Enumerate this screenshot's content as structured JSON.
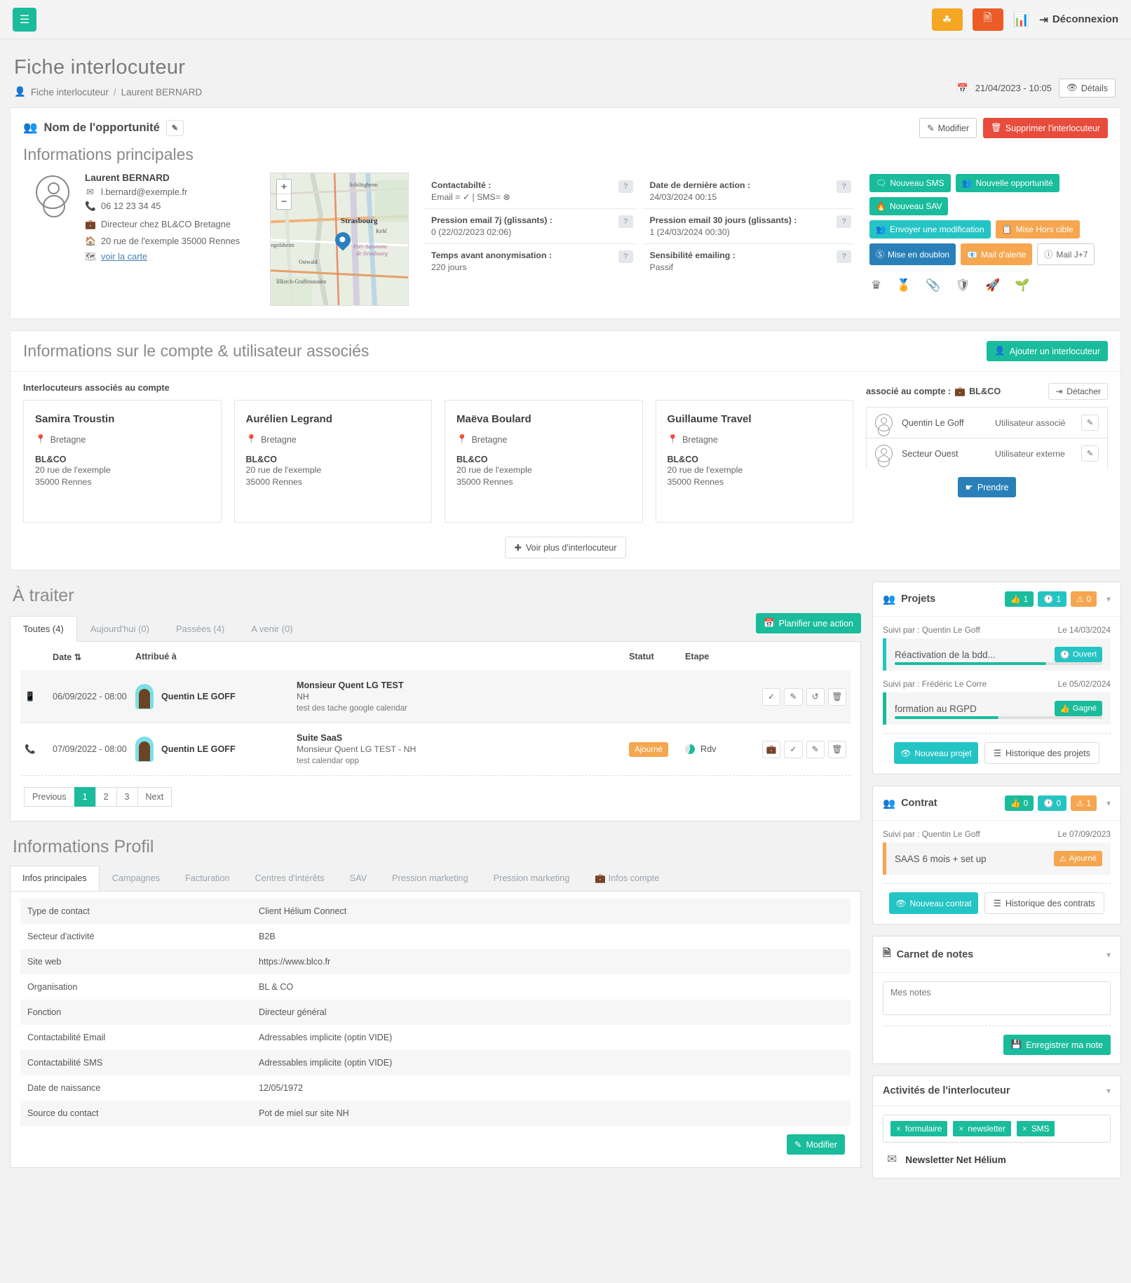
{
  "topbar": {
    "menu_icon": "hamburger-icon",
    "bulb_icon": "lightbulb-icon",
    "doc_icon": "document-alert-icon",
    "activity_icon": "activity-monitor-icon",
    "logout_label": "Déconnexion"
  },
  "page": {
    "title": "Fiche interlocuteur",
    "breadcrumb_root": "Fiche interlocuteur",
    "breadcrumb_sep": "/",
    "breadcrumb_current": "Laurent BERNARD",
    "timestamp": "21/04/2023 - 10:05",
    "details_label": "Détails"
  },
  "opportunity": {
    "title": "Nom de l'opportunité",
    "edit_label": "Modifier",
    "delete_label": "Supprimer l'interlocuteur"
  },
  "main_info": {
    "section_title": "Informations principales",
    "contact": {
      "name": "Laurent BERNARD",
      "email": "l.bernard@exemple.fr",
      "phone": "06 12 23 34 45",
      "job": "Directeur chez BL&CO Bretagne",
      "address": "20 rue de l'exemple 35000 Rennes",
      "map_link": "voir la carte"
    },
    "map": {
      "zoom_in": "+",
      "zoom_out": "−",
      "labels": [
        "Schiltigheim",
        "Strasbourg",
        "Kehl",
        "Ostwald",
        "Illkirch-Graffenstaden",
        "Lingolsheim",
        "Port Autonome de Strasbourg"
      ]
    },
    "fields": [
      {
        "label": "Contactabilté :",
        "value": "Email = ✓ | SMS= ⊗",
        "help": "?"
      },
      {
        "label": "Date de dernière action :",
        "value": "24/03/2024 00:15",
        "help": "?"
      },
      {
        "label": "Pression email 7j (glissants) :",
        "value": "0 (22/02/2023 02:06)",
        "help": "?"
      },
      {
        "label": "Pression email 30 jours (glissants) :",
        "value": "1 (24/03/2024 00:30)",
        "help": "?"
      },
      {
        "label": "Temps avant anonymisation :",
        "value": "220 jours",
        "help": "?"
      },
      {
        "label": "Sensibilité emailing :",
        "value": "Passif",
        "help": "?"
      }
    ],
    "actions_row1": [
      {
        "label": "Nouveau SMS",
        "icon": "sms-icon",
        "style": "g"
      },
      {
        "label": "Nouvelle opportunité",
        "icon": "user-plus-icon",
        "style": "g"
      },
      {
        "label": "Nouveau SAV",
        "icon": "fire-icon",
        "style": "g"
      }
    ],
    "actions_row2": [
      {
        "label": "Envoyer une modification",
        "icon": "users-icon",
        "style": "t"
      },
      {
        "label": "Mise Hors cible",
        "icon": "target-off-icon",
        "style": "o"
      }
    ],
    "actions_row3": [
      {
        "label": "Mise en doublon",
        "icon": "duplicate-icon",
        "style": "b"
      },
      {
        "label": "Mail d'alerte",
        "icon": "mail-alert-icon",
        "style": "o"
      },
      {
        "label": "Mail J+7",
        "icon": "clock-icon",
        "style": "w"
      }
    ],
    "status_icons": [
      "crown-icon",
      "medal-icon",
      "paperclip-icon",
      "shield-icon",
      "rocket-icon",
      "seedling-icon"
    ]
  },
  "account": {
    "section_title": "Informations sur le compte & utilisateur associés",
    "add_button": "Ajouter un interlocuteur",
    "list_label": "Interlocuteurs associés au compte",
    "people": [
      {
        "name": "Samira Troustin",
        "region": "Bretagne",
        "company": "BL&CO",
        "street": "20 rue de l'exemple",
        "city": "35000 Rennes"
      },
      {
        "name": "Aurélien Legrand",
        "region": "Bretagne",
        "company": "BL&CO",
        "street": "20 rue de l'exemple",
        "city": "35000 Rennes"
      },
      {
        "name": "Maëva Boulard",
        "region": "Bretagne",
        "company": "BL&CO",
        "street": "20 rue de l'exemple",
        "city": "35000 Rennes"
      },
      {
        "name": "Guillaume Travel",
        "region": "Bretagne",
        "company": "BL&CO",
        "street": "20 rue de l'exemple",
        "city": "35000 Rennes"
      }
    ],
    "more_button": "Voir plus d'interlocuteur",
    "linked_label": "associé au compte :",
    "linked_account": "BL&CO",
    "detach_button": "Détacher",
    "users": [
      {
        "name": "Quentin Le Goff",
        "role": "Utilisateur associé"
      },
      {
        "name": "Secteur Ouest",
        "role": "Utilisateur externe"
      }
    ],
    "take_button": "Prendre"
  },
  "todo": {
    "title": "À traiter",
    "tabs": [
      {
        "label": "Toutes (4)",
        "active": true
      },
      {
        "label": "Aujourd'hui (0)",
        "active": false
      },
      {
        "label": "Passées (4)",
        "active": false
      },
      {
        "label": "A venir (0)",
        "active": false
      }
    ],
    "plan_button": "Planifier une action",
    "columns": [
      "",
      "Date",
      "Attribué à",
      "",
      "Statut",
      "Etape",
      ""
    ],
    "rows": [
      {
        "type_icon": "mobile-icon",
        "date": "06/09/2022 - 08:00",
        "assignee": "Quentin LE GOFF",
        "object_title": "Monsieur Quent LG TEST",
        "object_sub": "NH",
        "object_note": "test des tache google calendar",
        "status": "",
        "etape": "",
        "actions": [
          "check-icon",
          "pencil-icon",
          "history-icon",
          "trash-icon"
        ]
      },
      {
        "type_icon": "phone-icon",
        "date": "07/09/2022 - 08:00",
        "assignee": "Quentin LE GOFF",
        "object_title": "Suite SaaS",
        "object_sub": "Monsieur Quent LG TEST - NH",
        "object_note": "test calendar opp",
        "status": "Ajourné",
        "etape": "Rdv",
        "actions": [
          "briefcase-icon",
          "check-icon",
          "pencil-icon",
          "trash-icon"
        ]
      }
    ],
    "pagination": [
      "Previous",
      "1",
      "2",
      "3",
      "Next"
    ],
    "pagination_active": "1"
  },
  "profile": {
    "title": "Informations Profil",
    "tabs": [
      {
        "label": "Infos principales",
        "active": true
      },
      {
        "label": "Campagnes",
        "active": false
      },
      {
        "label": "Facturation",
        "active": false
      },
      {
        "label": "Centres d'intérêts",
        "active": false
      },
      {
        "label": "SAV",
        "active": false
      },
      {
        "label": "Pression marketing",
        "active": false
      },
      {
        "label": "Pression marketing",
        "active": false
      },
      {
        "label": "Infos compte",
        "active": false,
        "icon": "briefcase-icon"
      }
    ],
    "rows": [
      {
        "key": "Type de contact",
        "value": "Client Hélium Connect"
      },
      {
        "key": "Secteur d'activité",
        "value": "B2B"
      },
      {
        "key": "Site web",
        "value": "https://www.blco.fr"
      },
      {
        "key": "Organisation",
        "value": "BL & CO"
      },
      {
        "key": "Fonction",
        "value": "Directeur général"
      },
      {
        "key": "Contactabilité Email",
        "value": "Adressables implicite (optin VIDE)"
      },
      {
        "key": "Contactabilité SMS",
        "value": "Adressables implicite (optin VIDE)"
      },
      {
        "key": "Date de naissance",
        "value": "12/05/1972"
      },
      {
        "key": "Source du contact",
        "value": "Pot de miel sur site NH"
      }
    ],
    "edit_button": "Modifier"
  },
  "projects": {
    "title": "Projets",
    "counts": [
      {
        "icon": "thumbs-up-icon",
        "value": "1",
        "color": "#1abc9c"
      },
      {
        "icon": "clock-icon",
        "value": "1",
        "color": "#25c4c4"
      },
      {
        "icon": "warning-icon",
        "value": "0",
        "color": "#f5a64f"
      }
    ],
    "items": [
      {
        "owner": "Suivi par : Quentin Le Goff",
        "date": "Le 14/03/2024",
        "name": "Réactivation de la bdd...",
        "status": "Ouvert",
        "status_icon": "clock-icon",
        "status_color": "#25c4c4",
        "bar_color": "#25c4c4",
        "progress": 73
      },
      {
        "owner": "Suivi par : Frédéric Le Corre",
        "date": "Le 05/02/2024",
        "name": "formation au RGPD",
        "status": "Gagné",
        "status_icon": "thumbs-up-icon",
        "status_color": "#1abc9c",
        "bar_color": "#1abc9c",
        "progress": 50
      }
    ],
    "new_button": "Nouveau projet",
    "history_button": "Historique des projets"
  },
  "contract": {
    "title": "Contrat",
    "counts": [
      {
        "icon": "thumbs-up-icon",
        "value": "0",
        "color": "#1abc9c"
      },
      {
        "icon": "clock-icon",
        "value": "0",
        "color": "#25c4c4"
      },
      {
        "icon": "warning-icon",
        "value": "1",
        "color": "#f5a64f"
      }
    ],
    "items": [
      {
        "owner": "Suivi par : Quentin Le Goff",
        "date": "Le 07/09/2023",
        "name": "SAAS 6 mois + set up",
        "status": "Ajourné",
        "status_icon": "warning-icon",
        "status_color": "#f5a64f",
        "bar_color": "#f5a64f",
        "progress": 0
      }
    ],
    "new_button": "Nouveau contrat",
    "history_button": "Historique des contrats"
  },
  "notes": {
    "title": "Carnet de notes",
    "placeholder": "Mes notes",
    "save_button": "Enregistrer ma note"
  },
  "activities": {
    "title": "Activités de l'interlocuteur",
    "chips": [
      "formulaire",
      "newsletter",
      "SMS"
    ],
    "newsletter_title": "Newsletter Net Hélium"
  }
}
